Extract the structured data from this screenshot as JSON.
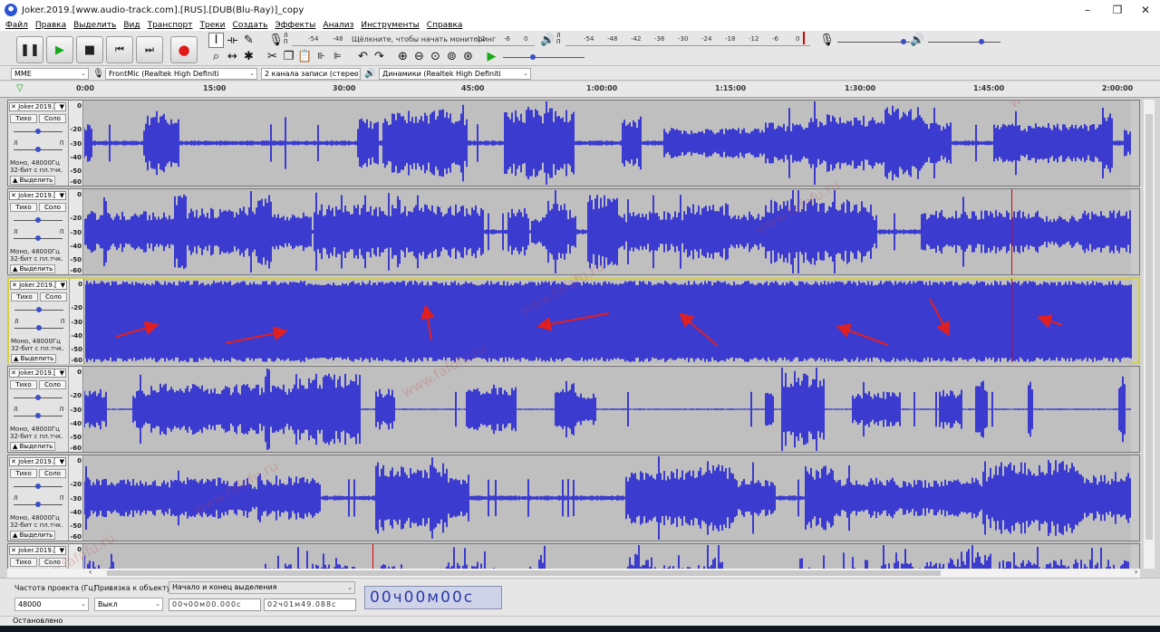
{
  "window": {
    "title": "Joker.2019.[www.audio-track.com].[RUS].[DUB(Blu-Ray)]_copy",
    "minimize": "–",
    "maximize": "❐",
    "close": "✕"
  },
  "menu": [
    "Файл",
    "Правка",
    "Выделить",
    "Вид",
    "Транспорт",
    "Треки",
    "Создать",
    "Эффекты",
    "Анализ",
    "Инструменты",
    "Справка"
  ],
  "transport": {
    "pause": "❚❚",
    "play": "▶",
    "stop": "■",
    "skip_start": "⏮",
    "skip_end": "⏭",
    "record": "●"
  },
  "meter": {
    "record_ticks": [
      "-54",
      "-48",
      "-12",
      "-6",
      "0"
    ],
    "record_hint": "Щёлкните, чтобы начать мониторинг",
    "playback_ticks": [
      "-54",
      "-48",
      "-42",
      "-36",
      "-30",
      "-24",
      "-18",
      "-12",
      "-6",
      "0"
    ],
    "ch_left": "Л",
    "ch_right": "П"
  },
  "devices": {
    "host": "MME",
    "mic": "FrontMic (Realtek High Definiti",
    "channels": "2 канала записи (стерео)",
    "speaker": "Динамики (Realtek High Definiti"
  },
  "ruler": [
    "0:00",
    "15:00",
    "30:00",
    "45:00",
    "1:00:00",
    "1:15:00",
    "1:30:00",
    "1:45:00",
    "2:00:00"
  ],
  "tracks": [
    {
      "name": "Joker.2019.[",
      "mute": "Тихо",
      "solo": "Соло",
      "pan_l": "Л",
      "pan_r": "П",
      "format1": "Моно, 48000Гц",
      "format2": "32-бит с пл.тчк.",
      "select": "Выделить"
    },
    {
      "name": "Joker.2019.[",
      "mute": "Тихо",
      "solo": "Соло",
      "pan_l": "Л",
      "pan_r": "П",
      "format1": "Моно, 48000Гц",
      "format2": "32-бит с пл.тчк.",
      "select": "Выделить"
    },
    {
      "name": "Joker.2019.[",
      "mute": "Тихо",
      "solo": "Соло",
      "pan_l": "Л",
      "pan_r": "П",
      "format1": "Моно, 48000Гц",
      "format2": "32-бит с пл.тчк.",
      "select": "Выделить"
    },
    {
      "name": "Joker.2019.[",
      "mute": "Тихо",
      "solo": "Соло",
      "pan_l": "Л",
      "pan_r": "П",
      "format1": "Моно, 48000Гц",
      "format2": "32-бит с пл.тчк.",
      "select": "Выделить"
    },
    {
      "name": "Joker.2019.[",
      "mute": "Тихо",
      "solo": "Соло",
      "pan_l": "Л",
      "pan_r": "П",
      "format1": "Моно, 48000Гц",
      "format2": "32-бит с пл.тчк.",
      "select": "Выделить"
    },
    {
      "name": "Joker.2019.[",
      "mute": "Тихо",
      "solo": "Соло"
    }
  ],
  "db_labels": [
    "0",
    "-20",
    "-30",
    "-40",
    "-50",
    "-60"
  ],
  "selection": {
    "rate_label": "Частота проекта (Гц)",
    "rate_value": "48000",
    "snap_label": "Привязка к объекту",
    "snap_value": "Выкл",
    "mode_label": "Начало и конец выделения",
    "start_time": "00ч00м00.000с",
    "end_time": "02ч01м49.088с",
    "position": "00ч00м00с"
  },
  "status": "Остановлено",
  "watermark": "www.fafofu.ru",
  "colors": {
    "waveform": "#3b3bd0",
    "waveform_bg": "#bfbfbf",
    "selected_border": "#d4cf43",
    "cursor": "#dd0000",
    "arrow": "#e02020"
  }
}
